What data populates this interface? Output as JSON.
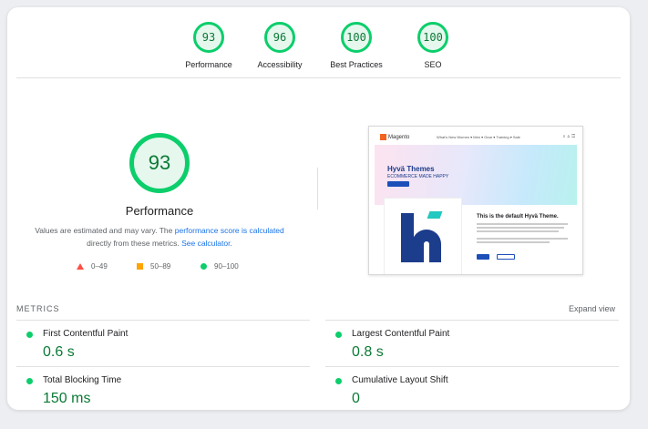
{
  "scores": [
    {
      "label": "Performance",
      "value": "93"
    },
    {
      "label": "Accessibility",
      "value": "96"
    },
    {
      "label": "Best Practices",
      "value": "100"
    },
    {
      "label": "SEO",
      "value": "100"
    }
  ],
  "performance": {
    "score": "93",
    "title": "Performance",
    "desc_prefix": "Values are estimated and may vary. The ",
    "desc_link": "performance score is calculated",
    "desc_mid": " directly from these metrics. ",
    "desc_link2": "See calculator.",
    "legend": [
      "0–49",
      "50–89",
      "90–100"
    ]
  },
  "screenshot": {
    "logo": "Magento",
    "nav": "What's New   Women ▾   Men ▾   Gear ▾   Training ▾   Sale",
    "hero_title": "Hyvä Themes",
    "hero_subtitle": "ECOMMERCE MADE HAPPY",
    "default_title": "This is the default Hyvä Theme."
  },
  "metrics": {
    "heading": "METRICS",
    "expand": "Expand view",
    "items": [
      {
        "name": "First Contentful Paint",
        "value": "0.6 s"
      },
      {
        "name": "Largest Contentful Paint",
        "value": "0.8 s"
      },
      {
        "name": "Total Blocking Time",
        "value": "150 ms"
      },
      {
        "name": "Cumulative Layout Shift",
        "value": "0"
      }
    ]
  },
  "colors": {
    "pass": "#0cce6b",
    "average": "#ffa400",
    "fail": "#ff4e42"
  }
}
